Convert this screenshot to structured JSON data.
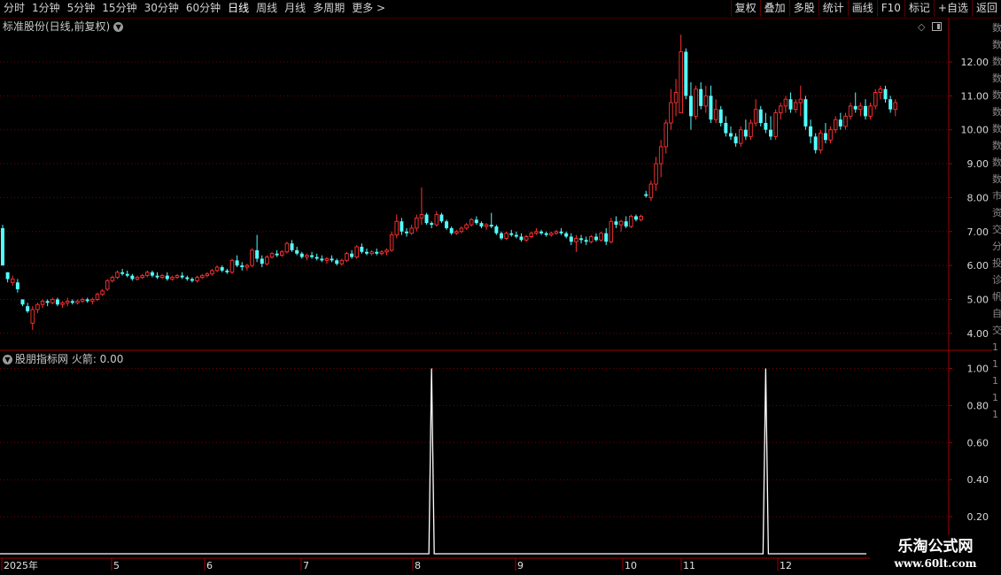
{
  "toolbar": {
    "periods": [
      "分时",
      "1分钟",
      "5分钟",
      "15分钟",
      "30分钟",
      "60分钟",
      "日线",
      "周线",
      "月线",
      "多周期",
      "更多 >"
    ],
    "active_period": "日线",
    "right_buttons": [
      "复权",
      "叠加",
      "多股",
      "统计",
      "画线",
      "F10",
      "标记",
      "+自选",
      "返回"
    ]
  },
  "main_title": "标准股份(日线,前复权)",
  "indicator_title": "股朋指标网 火箭: 0.00",
  "x_axis_labels": [
    "2025年",
    "5",
    "6",
    "7",
    "8",
    "9",
    "10",
    "11",
    "12"
  ],
  "side_strip_chars": [
    "数",
    "数",
    "数",
    "数",
    "数",
    "数",
    "数",
    "数",
    "数",
    "数",
    "市",
    "资",
    "交",
    "分",
    "投",
    "诊",
    "帆",
    "自",
    "交",
    "1",
    "1",
    "1",
    "1",
    "1"
  ],
  "watermark": {
    "title": "乐淘公式网",
    "url": "www.60lt.com"
  },
  "colors": {
    "up": "#ff3232",
    "down": "#54fcfc",
    "grid": "#7a0000",
    "axis": "#a00000",
    "line": "#ffffff"
  },
  "chart_data": [
    {
      "type": "candlestick",
      "title": "标准股份(日线,前复权)",
      "y_ticks": [
        "12.00",
        "11.00",
        "10.00",
        "9.00",
        "8.00",
        "7.00",
        "6.00",
        "5.00",
        "4.00"
      ],
      "ylim": [
        3.72,
        12.95
      ],
      "grid": true,
      "x_labels": [
        "2025年",
        "5",
        "6",
        "7",
        "8",
        "9",
        "10",
        "11",
        "12"
      ],
      "candles_ohlc": [
        [
          7.1,
          7.2,
          6.0,
          6.0
        ],
        [
          5.8,
          5.8,
          5.5,
          5.6
        ],
        [
          5.5,
          5.7,
          5.4,
          5.6
        ],
        [
          5.5,
          5.6,
          5.2,
          5.3
        ],
        [
          5.0,
          5.0,
          4.8,
          4.85
        ],
        [
          4.8,
          4.9,
          4.6,
          4.65
        ],
        [
          4.3,
          4.8,
          4.1,
          4.7
        ],
        [
          4.7,
          4.9,
          4.6,
          4.85
        ],
        [
          4.85,
          5.0,
          4.75,
          4.95
        ],
        [
          4.95,
          5.0,
          4.8,
          4.9
        ],
        [
          4.9,
          5.05,
          4.85,
          5.0
        ],
        [
          5.0,
          5.05,
          4.8,
          4.85
        ],
        [
          4.85,
          4.95,
          4.75,
          4.9
        ],
        [
          4.9,
          5.05,
          4.8,
          4.95
        ],
        [
          4.95,
          5.0,
          4.85,
          4.9
        ],
        [
          4.9,
          5.0,
          4.85,
          4.95
        ],
        [
          4.95,
          5.05,
          4.9,
          5.0
        ],
        [
          5.0,
          5.05,
          4.9,
          4.95
        ],
        [
          4.95,
          5.05,
          4.85,
          5.0
        ],
        [
          5.0,
          5.2,
          4.95,
          5.15
        ],
        [
          5.15,
          5.3,
          5.1,
          5.25
        ],
        [
          5.3,
          5.6,
          5.25,
          5.55
        ],
        [
          5.55,
          5.7,
          5.5,
          5.65
        ],
        [
          5.65,
          5.85,
          5.6,
          5.8
        ],
        [
          5.8,
          5.9,
          5.7,
          5.75
        ],
        [
          5.75,
          5.85,
          5.65,
          5.7
        ],
        [
          5.7,
          5.75,
          5.55,
          5.6
        ],
        [
          5.6,
          5.7,
          5.55,
          5.65
        ],
        [
          5.65,
          5.75,
          5.6,
          5.7
        ],
        [
          5.7,
          5.85,
          5.65,
          5.8
        ],
        [
          5.8,
          5.85,
          5.65,
          5.7
        ],
        [
          5.7,
          5.8,
          5.6,
          5.65
        ],
        [
          5.65,
          5.75,
          5.6,
          5.7
        ],
        [
          5.7,
          5.8,
          5.55,
          5.6
        ],
        [
          5.6,
          5.7,
          5.55,
          5.65
        ],
        [
          5.65,
          5.75,
          5.6,
          5.7
        ],
        [
          5.7,
          5.8,
          5.6,
          5.65
        ],
        [
          5.65,
          5.7,
          5.55,
          5.6
        ],
        [
          5.6,
          5.65,
          5.5,
          5.55
        ],
        [
          5.55,
          5.7,
          5.5,
          5.65
        ],
        [
          5.65,
          5.75,
          5.6,
          5.7
        ],
        [
          5.7,
          5.8,
          5.65,
          5.75
        ],
        [
          5.75,
          5.9,
          5.7,
          5.85
        ],
        [
          5.85,
          6.0,
          5.8,
          5.95
        ],
        [
          5.95,
          6.0,
          5.8,
          5.85
        ],
        [
          5.85,
          5.9,
          5.75,
          5.8
        ],
        [
          5.8,
          6.2,
          5.75,
          6.15
        ],
        [
          6.15,
          6.3,
          5.95,
          6.0
        ],
        [
          6.0,
          6.1,
          5.85,
          5.95
        ],
        [
          5.95,
          6.05,
          5.85,
          6.0
        ],
        [
          6.0,
          6.5,
          5.95,
          6.45
        ],
        [
          6.45,
          6.9,
          6.1,
          6.2
        ],
        [
          6.2,
          6.3,
          5.95,
          6.05
        ],
        [
          6.05,
          6.3,
          6.0,
          6.25
        ],
        [
          6.25,
          6.4,
          6.2,
          6.35
        ],
        [
          6.35,
          6.45,
          6.25,
          6.3
        ],
        [
          6.3,
          6.45,
          6.25,
          6.4
        ],
        [
          6.4,
          6.7,
          6.35,
          6.65
        ],
        [
          6.65,
          6.75,
          6.4,
          6.45
        ],
        [
          6.45,
          6.55,
          6.3,
          6.35
        ],
        [
          6.35,
          6.4,
          6.2,
          6.25
        ],
        [
          6.25,
          6.35,
          6.15,
          6.3
        ],
        [
          6.3,
          6.4,
          6.2,
          6.25
        ],
        [
          6.25,
          6.35,
          6.15,
          6.2
        ],
        [
          6.2,
          6.3,
          6.1,
          6.15
        ],
        [
          6.15,
          6.25,
          6.05,
          6.2
        ],
        [
          6.2,
          6.3,
          6.1,
          6.15
        ],
        [
          6.15,
          6.2,
          6.0,
          6.05
        ],
        [
          6.05,
          6.2,
          6.0,
          6.15
        ],
        [
          6.15,
          6.4,
          6.1,
          6.35
        ],
        [
          6.35,
          6.45,
          6.2,
          6.25
        ],
        [
          6.25,
          6.6,
          6.2,
          6.55
        ],
        [
          6.55,
          6.65,
          6.35,
          6.4
        ],
        [
          6.4,
          6.5,
          6.3,
          6.35
        ],
        [
          6.35,
          6.45,
          6.3,
          6.4
        ],
        [
          6.4,
          6.5,
          6.3,
          6.35
        ],
        [
          6.35,
          6.45,
          6.3,
          6.4
        ],
        [
          6.4,
          6.5,
          6.3,
          6.45
        ],
        [
          6.45,
          7.0,
          6.4,
          6.9
        ],
        [
          6.9,
          7.5,
          6.8,
          7.3
        ],
        [
          7.3,
          7.4,
          6.9,
          7.0
        ],
        [
          7.0,
          7.1,
          6.85,
          6.95
        ],
        [
          6.95,
          7.2,
          6.9,
          7.1
        ],
        [
          7.1,
          7.5,
          7.0,
          7.4
        ],
        [
          7.4,
          8.3,
          7.2,
          7.5
        ],
        [
          7.5,
          7.55,
          7.2,
          7.25
        ],
        [
          7.25,
          7.3,
          7.1,
          7.2
        ],
        [
          7.2,
          7.6,
          7.15,
          7.5
        ],
        [
          7.5,
          7.55,
          7.25,
          7.3
        ],
        [
          7.3,
          7.35,
          7.05,
          7.1
        ],
        [
          7.1,
          7.15,
          6.9,
          6.95
        ],
        [
          6.95,
          7.05,
          6.9,
          7.0
        ],
        [
          7.0,
          7.15,
          6.95,
          7.1
        ],
        [
          7.1,
          7.25,
          7.05,
          7.2
        ],
        [
          7.2,
          7.4,
          7.15,
          7.35
        ],
        [
          7.35,
          7.45,
          7.2,
          7.25
        ],
        [
          7.25,
          7.3,
          7.1,
          7.15
        ],
        [
          7.15,
          7.25,
          7.05,
          7.2
        ],
        [
          7.2,
          7.55,
          7.1,
          7.15
        ],
        [
          7.15,
          7.2,
          6.9,
          6.95
        ],
        [
          6.95,
          7.0,
          6.75,
          6.8
        ],
        [
          6.8,
          7.0,
          6.75,
          6.95
        ],
        [
          6.95,
          7.05,
          6.85,
          6.9
        ],
        [
          6.9,
          7.0,
          6.8,
          6.85
        ],
        [
          6.85,
          6.95,
          6.7,
          6.75
        ],
        [
          6.75,
          6.9,
          6.7,
          6.85
        ],
        [
          6.85,
          7.0,
          6.8,
          6.95
        ],
        [
          6.95,
          7.1,
          6.9,
          7.0
        ],
        [
          7.0,
          7.05,
          6.9,
          6.95
        ],
        [
          6.95,
          7.0,
          6.85,
          6.9
        ],
        [
          6.9,
          7.0,
          6.85,
          6.95
        ],
        [
          6.95,
          7.05,
          6.9,
          7.0
        ],
        [
          7.0,
          7.1,
          6.9,
          6.95
        ],
        [
          6.95,
          7.0,
          6.8,
          6.85
        ],
        [
          6.85,
          6.95,
          6.6,
          6.7
        ],
        [
          6.7,
          6.9,
          6.4,
          6.8
        ],
        [
          6.8,
          6.9,
          6.65,
          6.75
        ],
        [
          6.75,
          6.85,
          6.6,
          6.7
        ],
        [
          6.7,
          6.9,
          6.65,
          6.85
        ],
        [
          6.85,
          6.95,
          6.7,
          6.75
        ],
        [
          6.75,
          7.0,
          6.7,
          6.95
        ],
        [
          6.95,
          7.1,
          6.6,
          6.7
        ],
        [
          6.7,
          7.4,
          6.65,
          7.3
        ],
        [
          7.3,
          7.45,
          7.1,
          7.2
        ],
        [
          7.2,
          7.35,
          7.0,
          7.3
        ],
        [
          7.3,
          7.45,
          7.1,
          7.15
        ],
        [
          7.15,
          7.5,
          7.1,
          7.45
        ],
        [
          7.45,
          7.5,
          7.3,
          7.35
        ],
        [
          7.35,
          7.5,
          7.3,
          7.45
        ],
        [
          8.1,
          8.2,
          8.0,
          8.05
        ],
        [
          8.0,
          8.5,
          7.9,
          8.4
        ],
        [
          8.4,
          9.2,
          8.2,
          9.0
        ],
        [
          9.0,
          9.7,
          8.6,
          9.5
        ],
        [
          9.5,
          10.3,
          9.3,
          10.2
        ],
        [
          10.2,
          11.2,
          10.0,
          10.8
        ],
        [
          10.8,
          11.5,
          10.4,
          11.1
        ],
        [
          10.5,
          12.8,
          10.6,
          12.3
        ],
        [
          12.3,
          12.4,
          10.9,
          11.0
        ],
        [
          11.0,
          11.4,
          10.0,
          10.4
        ],
        [
          10.4,
          11.3,
          10.3,
          11.2
        ],
        [
          11.2,
          11.4,
          10.6,
          10.7
        ],
        [
          10.7,
          11.3,
          10.5,
          11.0
        ],
        [
          11.0,
          11.3,
          10.2,
          10.3
        ],
        [
          10.3,
          10.9,
          10.2,
          10.6
        ],
        [
          10.6,
          10.7,
          10.1,
          10.2
        ],
        [
          10.2,
          10.4,
          9.8,
          9.9
        ],
        [
          9.9,
          10.1,
          9.7,
          9.8
        ],
        [
          9.8,
          9.9,
          9.5,
          9.6
        ],
        [
          9.6,
          10.1,
          9.5,
          10.0
        ],
        [
          10.0,
          10.3,
          9.7,
          9.8
        ],
        [
          9.8,
          10.3,
          9.7,
          10.2
        ],
        [
          10.2,
          10.9,
          10.1,
          10.6
        ],
        [
          10.6,
          10.7,
          10.1,
          10.2
        ],
        [
          10.2,
          10.5,
          9.9,
          10.0
        ],
        [
          10.0,
          10.4,
          9.7,
          9.8
        ],
        [
          9.8,
          10.6,
          9.7,
          10.5
        ],
        [
          10.5,
          10.8,
          10.3,
          10.7
        ],
        [
          10.7,
          11.0,
          10.5,
          10.9
        ],
        [
          10.9,
          11.1,
          10.5,
          10.6
        ],
        [
          10.6,
          10.9,
          10.5,
          10.8
        ],
        [
          10.8,
          11.3,
          10.4,
          10.9
        ],
        [
          10.9,
          11.0,
          10.0,
          10.1
        ],
        [
          10.1,
          10.3,
          9.6,
          9.8
        ],
        [
          9.8,
          9.9,
          9.3,
          9.4
        ],
        [
          9.4,
          10.0,
          9.3,
          9.9
        ],
        [
          9.9,
          10.2,
          9.6,
          9.7
        ],
        [
          9.7,
          10.1,
          9.6,
          10.0
        ],
        [
          10.0,
          10.4,
          9.9,
          10.3
        ],
        [
          10.3,
          10.5,
          10.0,
          10.1
        ],
        [
          10.1,
          10.5,
          10.0,
          10.4
        ],
        [
          10.4,
          10.8,
          10.3,
          10.7
        ],
        [
          10.7,
          11.1,
          10.5,
          10.6
        ],
        [
          10.6,
          10.8,
          10.4,
          10.7
        ],
        [
          10.7,
          10.9,
          10.3,
          10.4
        ],
        [
          10.4,
          10.8,
          10.3,
          10.7
        ],
        [
          10.7,
          11.2,
          10.6,
          11.1
        ],
        [
          11.1,
          11.3,
          10.9,
          11.2
        ],
        [
          11.2,
          11.3,
          10.8,
          10.9
        ],
        [
          10.9,
          11.0,
          10.5,
          10.6
        ],
        [
          10.6,
          10.9,
          10.4,
          10.8
        ]
      ]
    },
    {
      "type": "line",
      "title": "股朋指标网 火箭: 0.00",
      "series": [
        {
          "name": "火箭",
          "spikes_at_candle_index": [
            86,
            153
          ],
          "spike_value": 1.0,
          "baseline": 0.0
        }
      ],
      "y_ticks": [
        "1.00",
        "0.80",
        "0.60",
        "0.40",
        "0.20"
      ],
      "ylim": [
        -0.05,
        1.0
      ]
    }
  ]
}
